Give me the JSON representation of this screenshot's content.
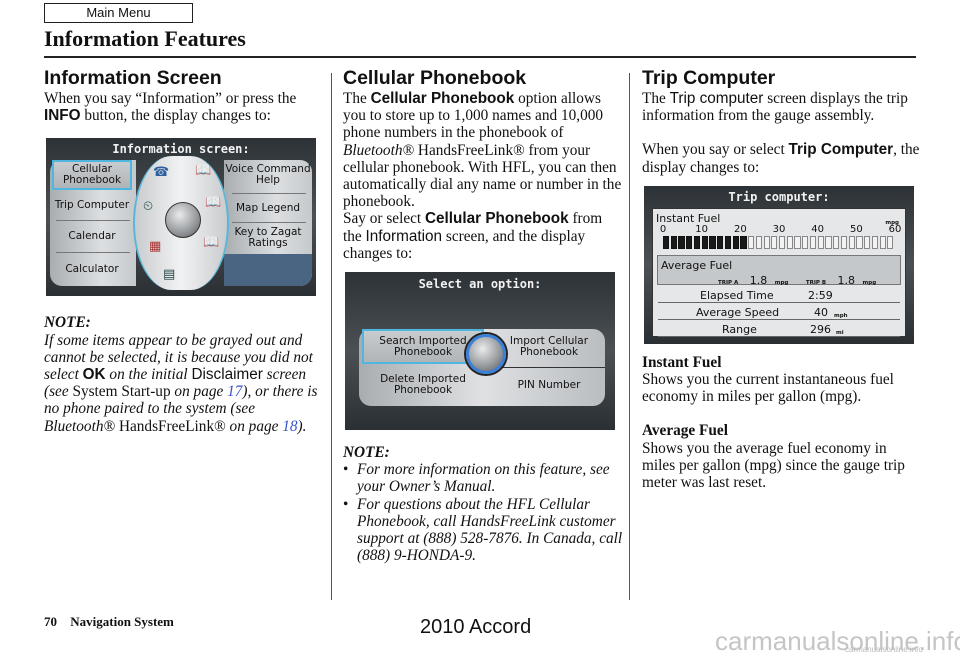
{
  "header": {
    "main_menu_label": "Main Menu",
    "page_title": "Information Features"
  },
  "col1": {
    "heading": "Information Screen",
    "intro": {
      "t1": "When you say “Information” or press the ",
      "kw": "INFO",
      "t2": " button, the display changes to:"
    },
    "screen": {
      "title": "Information screen:",
      "left_options": [
        "Cellular Phonebook",
        "Trip Computer",
        "Calendar",
        "Calculator"
      ],
      "right_options": [
        "Voice Command Help",
        "Map Legend",
        "Key to Zagat Ratings"
      ],
      "selected": "Cellular Phonebook",
      "icons": [
        "phone-icon",
        "voice-help-book-icon",
        "trip-computer-icon",
        "map-legend-book-icon",
        "calendar-icon",
        "zagat-book-icon",
        "calculator-icon"
      ]
    },
    "note": {
      "label": "NOTE:",
      "t1": "If some items appear to be grayed out and cannot be selected, it is because you did not select ",
      "ok": "OK",
      "t2": " on the initial ",
      "disclaimer": "Disclaimer",
      "t3": " screen (see ",
      "startup": "System Start-up",
      "t4": " on page ",
      "page1": "17",
      "t5": "), or there is no phone paired to the system (see Bluetooth®",
      "hfl": "HandsFreeLink®",
      "t6": " on page ",
      "page2": "18",
      "t7": ")."
    }
  },
  "col2": {
    "heading": "Cellular Phonebook",
    "p1": {
      "t1": "The ",
      "kw": "Cellular Phonebook",
      "t2": " option allows you to store up to 1,000 names and 10,000 phone numbers in the phonebook of ",
      "bt": "Bluetooth®",
      "t3": " HandsFreeLink® from your cellular phonebook. With HFL, you can then automatically dial any name or number in the phonebook."
    },
    "p2": {
      "t1": "Say or select ",
      "kw": "Cellular Phonebook",
      "t2": " from the ",
      "info": "Information",
      "t3": " screen, and the display changes to:"
    },
    "screen": {
      "title": "Select an option:",
      "options": [
        "Search Imported Phonebook",
        "Import Cellular Phonebook",
        "Delete Imported Phonebook",
        "PIN Number"
      ],
      "selected": "Search Imported Phonebook"
    },
    "note": {
      "label": "NOTE:",
      "bullets": [
        "For more information on this feature, see your Owner’s Manual.",
        "For questions about the HFL Cellular Phonebook, call HandsFreeLink customer support at (888) 528-7876. In Canada, call (888) 9-HONDA-9."
      ]
    }
  },
  "col3": {
    "heading": "Trip Computer",
    "p1": {
      "t1": "The ",
      "kw": "Trip computer",
      "t2": " screen displays the trip information from the gauge assembly."
    },
    "p2": {
      "t1": "When you say or select ",
      "kw": "Trip Computer",
      "t2": ", the display changes to:"
    },
    "screen": {
      "title": "Trip computer:",
      "instant_fuel_label": "Instant Fuel",
      "instant_unit": "mpg",
      "scale_labels": [
        "0",
        "10",
        "20",
        "30",
        "40",
        "50",
        "60"
      ],
      "scale_max": 60,
      "segments_total": 30,
      "segments_filled": 11,
      "instant_value_mpg": 22,
      "average_fuel_label": "Average Fuel",
      "trip_a_label": "TRIP A",
      "trip_a_value": "1.8",
      "trip_b_label": "TRIP B",
      "trip_b_value": "1.8",
      "avg_unit": "mpg",
      "rows": [
        {
          "label": "Elapsed Time",
          "value": "2:59",
          "unit": ""
        },
        {
          "label": "Average Speed",
          "value": "40",
          "unit": "mph"
        },
        {
          "label": "Range",
          "value": "296",
          "unit": "mi"
        }
      ]
    },
    "instant_fuel": {
      "heading": "Instant Fuel",
      "text": "Shows you the current instantaneous fuel economy in miles per gallon (mpg)."
    },
    "average_fuel": {
      "heading": "Average Fuel",
      "text": "Shows you the average fuel economy in miles per gallon (mpg) since the gauge trip meter was last reset."
    }
  },
  "footer": {
    "page_number": "70",
    "section": "Navigation System",
    "model": "2010 Accord",
    "watermark": "carmanualsonline.info",
    "watermark_small": "carmanualsonline.info"
  }
}
